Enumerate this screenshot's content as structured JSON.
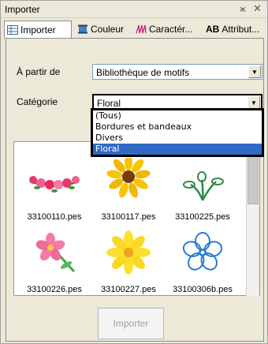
{
  "window": {
    "title": "Importer"
  },
  "tabs": [
    {
      "label": "Importer",
      "icon": "grid-icon",
      "active": true
    },
    {
      "label": "Couleur",
      "icon": "spool-icon"
    },
    {
      "label": "Caractér...",
      "icon": "stitch-pattern-icon"
    },
    {
      "label": "Attribut...",
      "icon": "text-ab-icon",
      "prefix": "AB"
    }
  ],
  "form": {
    "source_label": "À partir de",
    "source_value": "Bibliothèque de motifs",
    "category_label": "Catégorie",
    "category_value": "Floral"
  },
  "dropdown": {
    "options": [
      "(Tous)",
      "Bordures et bandeaux",
      "Divers",
      "Floral"
    ],
    "selected": "Floral"
  },
  "gallery": {
    "items": [
      {
        "file": "33100110.pes",
        "motif": "flower-garland-icon"
      },
      {
        "file": "33100117.pes",
        "motif": "sunflower-icon"
      },
      {
        "file": "33100225.pes",
        "motif": "branch-flower-icon"
      },
      {
        "file": "33100226.pes",
        "motif": "pink-flower-icon"
      },
      {
        "file": "33100227.pes",
        "motif": "yellow-daisy-icon"
      },
      {
        "file": "33100306b.pes",
        "motif": "blue-outline-flower-icon"
      }
    ]
  },
  "import_button": {
    "label": "Importer",
    "enabled": false
  },
  "colors": {
    "selection": "#316ac5",
    "panel": "#ece9d8"
  }
}
